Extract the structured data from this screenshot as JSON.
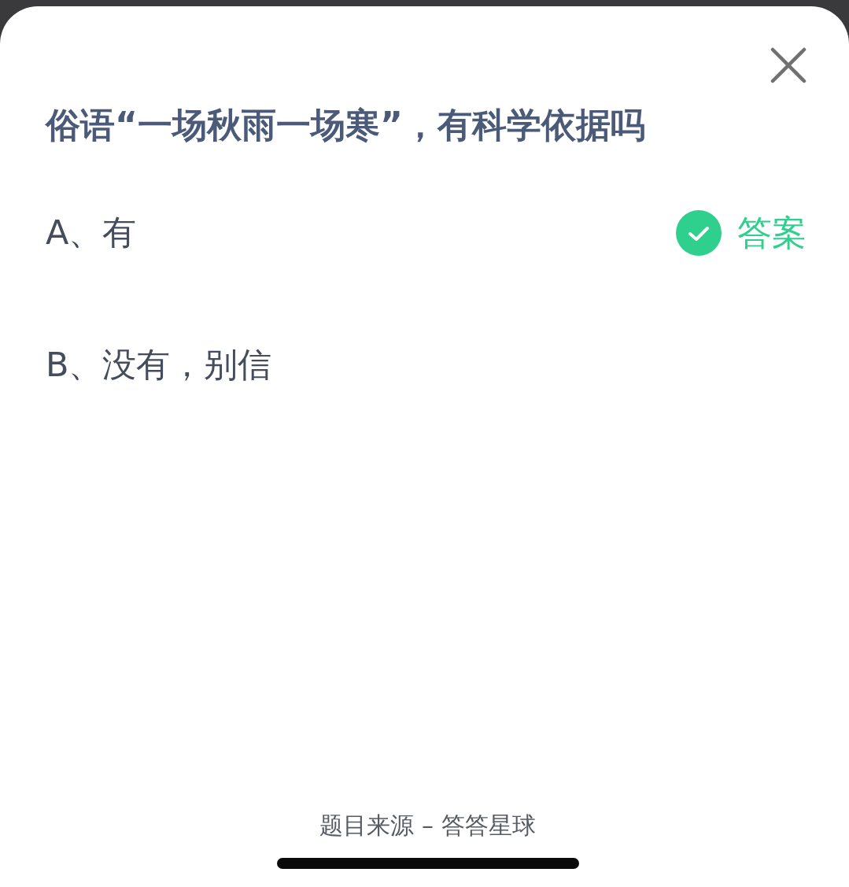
{
  "question": "俗语“一场秋雨一场寒”，有科学依据吗",
  "options": [
    {
      "label": "A、有",
      "correct": true
    },
    {
      "label": "B、没有，别信",
      "correct": false
    }
  ],
  "answer_label": "答案",
  "footer": "题目来源 – 答答星球"
}
